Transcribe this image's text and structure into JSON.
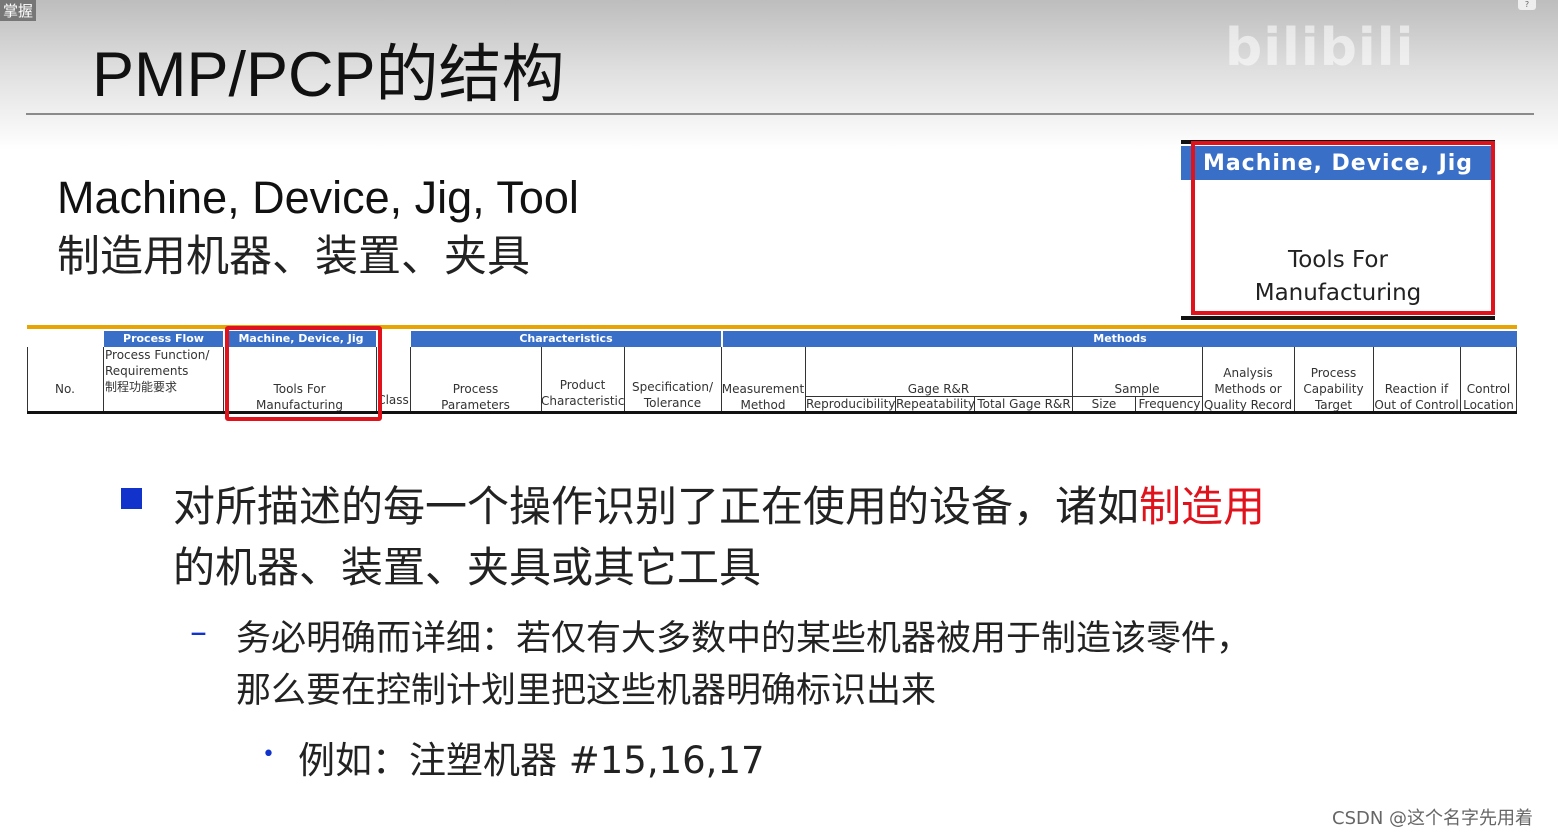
{
  "corner": {
    "label": "掌握",
    "icon": "?"
  },
  "watermark": {
    "text": "bilibili"
  },
  "slide": {
    "title": "PMP/PCP的结构",
    "heading_en": "Machine, Device, Jig, Tool",
    "heading_cn": "制造用机器、装置、夹具"
  },
  "callout": {
    "header": "Machine, Device, Jig",
    "line1": "Tools For",
    "line2": "Manufacturing"
  },
  "form": {
    "bands": {
      "process_flow": "Process Flow",
      "machine": "Machine, Device, Jig",
      "characteristics": "Characteristics",
      "methods": "Methods"
    },
    "cols": {
      "no": "No.",
      "pf1": "Process Function/",
      "pf2": "Requirements",
      "pf3": "制程功能要求",
      "tools1": "Tools For",
      "tools2": "Manufacturing",
      "class": "Class",
      "pp1": "Process",
      "pp2": "Parameters",
      "prod1": "Product",
      "prod2": "Characteristic",
      "spec1": "Specification/",
      "spec2": "Tolerance",
      "meas1": "Measurement",
      "meas2": "Method",
      "gage": "Gage R&R",
      "repro": "Reproducibility",
      "repeat": "Repeatability",
      "total": "Total Gage R&R",
      "sample": "Sample",
      "size": "Size",
      "freq": "Frequency",
      "anal1": "Analysis",
      "anal2": "Methods or",
      "anal3": "Quality Record",
      "cap1": "Process",
      "cap2": "Capability",
      "cap3": "Target",
      "react1": "Reaction if",
      "react2": "Out of Control",
      "ctrl1": "Control",
      "ctrl2": "Location"
    }
  },
  "bullets": {
    "main_part1": "对所描述的每一个操作识别了正在使用的设备，诸如",
    "main_highlight": "制造用",
    "main_line2": "的机器、装置、夹具或其它工具",
    "dash": "–",
    "sub_line1": "务必明确而详细：若仅有大多数中的某些机器被用于制造该零件，",
    "sub_line2": "那么要在控制计划里把这些机器明确标识出来",
    "dot": "•",
    "example": "例如：注塑机器 #15,16,17"
  },
  "footer": {
    "credit": "CSDN @这个名字先用着"
  },
  "colors": {
    "accent_blue": "#3a6fc8",
    "highlight_red": "#e0121b",
    "bullet_blue": "#1133cc",
    "orange_rule": "#e8a400"
  }
}
